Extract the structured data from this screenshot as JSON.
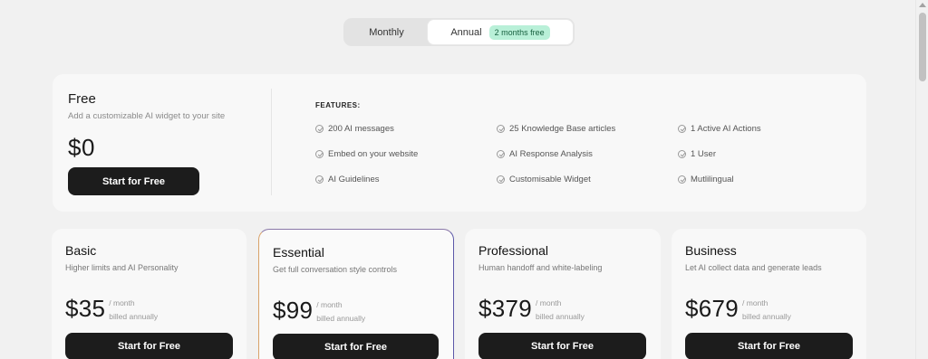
{
  "billing_toggle": {
    "monthly_label": "Monthly",
    "annual_label": "Annual",
    "annual_badge": "2 months free",
    "selected": "Annual"
  },
  "free_plan": {
    "name": "Free",
    "description": "Add a customizable AI widget to your site",
    "price": "$0",
    "cta": "Start for Free",
    "features_heading": "FEATURES:",
    "features": [
      "200 AI messages",
      "25 Knowledge Base articles",
      "1 Active AI Actions",
      "Embed on your website",
      "AI Response Analysis",
      "1 User",
      "AI Guidelines",
      "Customisable Widget",
      "Mutlilingual"
    ]
  },
  "plans": [
    {
      "name": "Basic",
      "description": "Higher limits and AI Personality",
      "price": "$35",
      "period": "/ month",
      "billing": "billed annually",
      "cta": "Start for Free"
    },
    {
      "name": "Essential",
      "description": "Get full conversation style controls",
      "price": "$99",
      "period": "/ month",
      "billing": "billed annually",
      "cta": "Start for Free"
    },
    {
      "name": "Professional",
      "description": "Human handoff and white-labeling",
      "price": "$379",
      "period": "/ month",
      "billing": "billed annually",
      "cta": "Start for Free"
    },
    {
      "name": "Business",
      "description": "Let AI collect data and generate leads",
      "price": "$679",
      "period": "/ month",
      "billing": "billed annually",
      "cta": "Start for Free"
    }
  ],
  "colors": {
    "page_bg": "#f1f1f1",
    "card_bg": "#f8f8f8",
    "button_bg": "#1c1c1c",
    "badge_bg": "#b9f0d8",
    "badge_text": "#17603f",
    "highlight_border": "#5b57a8"
  },
  "icons": {
    "feature_bullet": "check-circle-icon"
  }
}
